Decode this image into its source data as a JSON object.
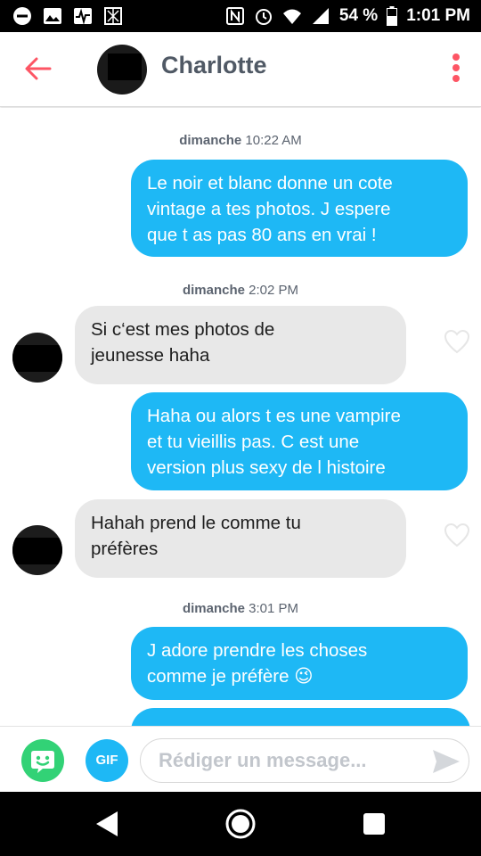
{
  "statusbar": {
    "battery": "54 %",
    "time": "1:01 PM",
    "icons": [
      "minus-circle-icon",
      "image-icon",
      "pulse-icon",
      "app-icon",
      "nfc-icon",
      "alarm-icon",
      "wifi-icon",
      "signal-icon",
      "battery-icon"
    ]
  },
  "header": {
    "name": "Charlotte",
    "back_icon": "arrow-left-icon",
    "menu_icon": "kebab-menu-icon",
    "accent_color": "#fd5564"
  },
  "messages": [
    {
      "type": "timestamp",
      "day": "dimanche",
      "time": "10:22 AM"
    },
    {
      "type": "out",
      "lines": [
        "Le noir et blanc donne un cote",
        "vintage a tes photos. J espere",
        "que t as pas 80 ans en vrai !"
      ]
    },
    {
      "type": "timestamp",
      "day": "dimanche",
      "time": "2:02 PM"
    },
    {
      "type": "in",
      "lines": [
        "Si c‘est mes photos de",
        "jeunesse haha"
      ]
    },
    {
      "type": "out",
      "lines": [
        "Haha ou alors t es une vampire",
        "et tu vieillis pas. C est une",
        "version plus sexy de l histoire"
      ]
    },
    {
      "type": "in",
      "lines": [
        "Hahah prend le comme tu",
        "préfères"
      ]
    },
    {
      "type": "timestamp",
      "day": "dimanche",
      "time": "3:01 PM"
    },
    {
      "type": "out",
      "lines": [
        "J adore prendre les choses",
        "comme je préfère 😉"
      ]
    }
  ],
  "input": {
    "placeholder": "Rédiger un message...",
    "gif_label": "GIF",
    "bitmoji_icon": "bitmoji-icon",
    "send_icon": "send-icon"
  },
  "colors": {
    "outgoing_bubble": "#1eb8f5",
    "incoming_bubble": "#e8e8e8",
    "bitmoji": "#32d276"
  },
  "navbar": {
    "icons": [
      "back-triangle-icon",
      "home-circle-icon",
      "recents-square-icon"
    ]
  }
}
